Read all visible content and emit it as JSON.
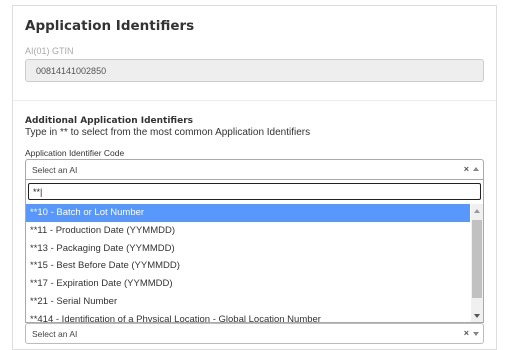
{
  "section": {
    "title": "Application Identifiers",
    "gtin_label": "AI(01) GTIN",
    "gtin_value": "00814141002850"
  },
  "additional": {
    "title": "Additional Application Identifiers",
    "description": "Type in ** to select from the most common Application Identifiers",
    "field_label": "Application Identifier Code"
  },
  "select_top": {
    "placeholder": "Select an AI",
    "clear_symbol": "×"
  },
  "dropdown": {
    "search_value": "**|",
    "options": [
      "**10 - Batch or Lot Number",
      "**11 - Production Date (YYMMDD)",
      "**13 - Packaging Date (YYMMDD)",
      "**15 - Best Before Date (YYMMDD)",
      "**17 - Expiration Date (YYMMDD)",
      "**21 - Serial Number",
      "**414 - Identification of a Physical Location - Global Location Number"
    ],
    "highlighted_index": 0
  },
  "select_bottom": {
    "placeholder": "Select an AI",
    "clear_symbol": "×"
  },
  "colors": {
    "highlight": "#5897fb",
    "disabled_field": "#eeeeee"
  }
}
